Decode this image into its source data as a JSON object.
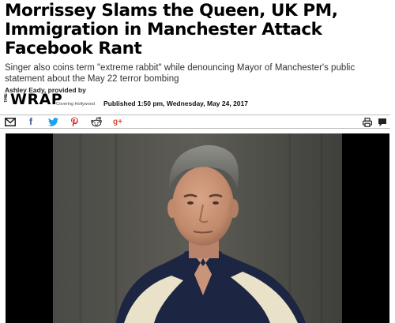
{
  "article": {
    "headline_lines": [
      "Morrissey Slams the Queen, UK PM,",
      "Immigration in Manchester Attack",
      "Facebook Rant"
    ],
    "subheadline": "Singer also coins term \"extreme rabbit\" while denouncing Mayor of Manchester's public statement about the May 22 terror bombing",
    "byline": "Ashley Eady, provided by",
    "published": "Published 1:50 pm, Wednesday, May 24, 2017"
  },
  "source_logo": {
    "the": "THE",
    "name": "WRAP",
    "tagline": "Covering Hollywood"
  },
  "share_bar": {
    "icons": [
      "email-icon",
      "facebook-icon",
      "twitter-icon",
      "pinterest-icon",
      "reddit-icon",
      "google-plus-icon",
      "print-icon",
      "comment-icon"
    ],
    "facebook_glyph": "f",
    "gplus_glyph": "g+"
  },
  "colors": {
    "facebook": "#3b5998",
    "twitter": "#1da1f2",
    "pinterest": "#cb2027",
    "google_plus": "#dd4b39"
  },
  "photo": {
    "subject": "man-photo"
  }
}
